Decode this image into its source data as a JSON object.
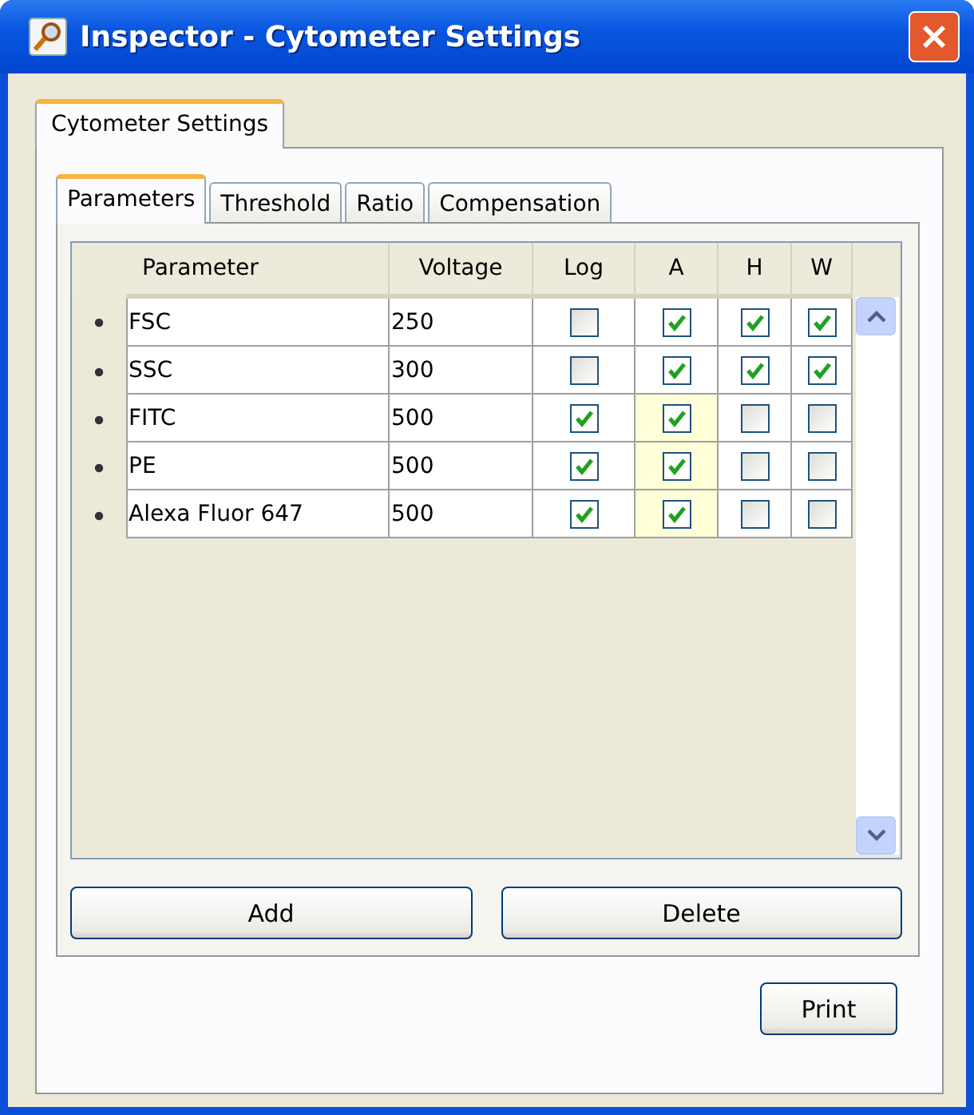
{
  "window": {
    "title": "Inspector - Cytometer Settings"
  },
  "outer_tabs": [
    {
      "label": "Cytometer Settings",
      "selected": true
    }
  ],
  "tabs": [
    {
      "label": "Parameters",
      "selected": true
    },
    {
      "label": "Threshold",
      "selected": false
    },
    {
      "label": "Ratio",
      "selected": false
    },
    {
      "label": "Compensation",
      "selected": false
    }
  ],
  "table": {
    "columns": [
      "Parameter",
      "Voltage",
      "Log",
      "A",
      "H",
      "W"
    ],
    "rows": [
      {
        "parameter": "FSC",
        "voltage": "250",
        "log": false,
        "a": true,
        "h": true,
        "w": true,
        "a_highlighted": false
      },
      {
        "parameter": "SSC",
        "voltage": "300",
        "log": false,
        "a": true,
        "h": true,
        "w": true,
        "a_highlighted": false
      },
      {
        "parameter": "FITC",
        "voltage": "500",
        "log": true,
        "a": true,
        "h": false,
        "w": false,
        "a_highlighted": true
      },
      {
        "parameter": "PE",
        "voltage": "500",
        "log": true,
        "a": true,
        "h": false,
        "w": false,
        "a_highlighted": true
      },
      {
        "parameter": "Alexa Fluor 647",
        "voltage": "500",
        "log": true,
        "a": true,
        "h": false,
        "w": false,
        "a_highlighted": true
      }
    ]
  },
  "buttons": [
    "Add",
    "Delete"
  ],
  "footer_buttons": [
    "Print"
  ]
}
